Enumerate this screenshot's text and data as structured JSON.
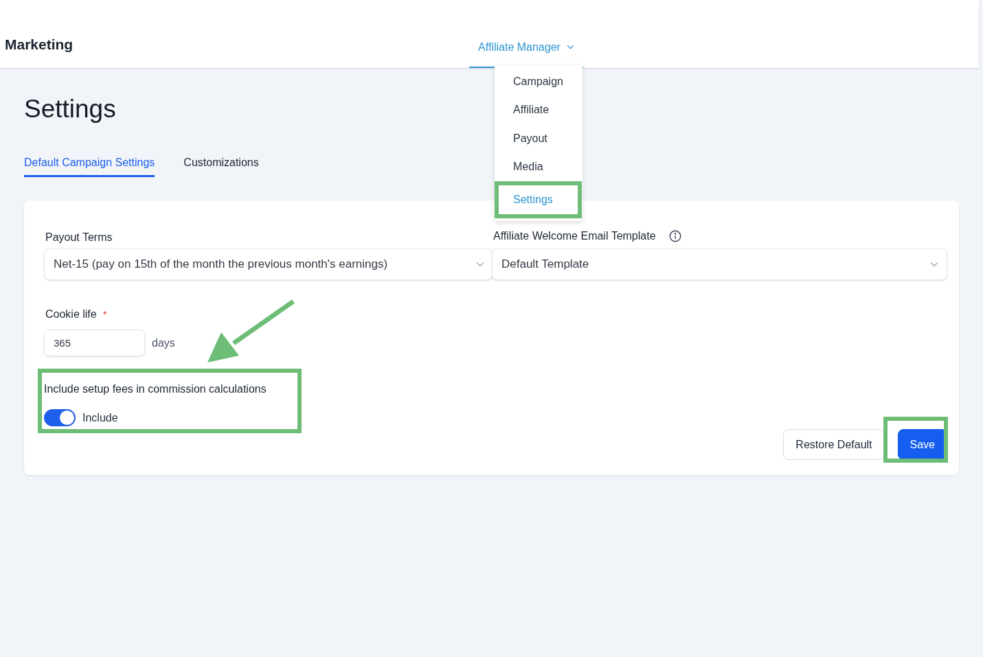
{
  "header": {
    "title": "Marketing",
    "nav_item": {
      "label": "Affiliate Manager",
      "expanded": true
    }
  },
  "nav_menu": [
    {
      "label": "Campaign",
      "selected": false
    },
    {
      "label": "Affiliate",
      "selected": false
    },
    {
      "label": "Payout",
      "selected": false
    },
    {
      "label": "Media",
      "selected": false
    },
    {
      "label": "Settings",
      "selected": true,
      "highlighted": true
    }
  ],
  "page_title": "Settings",
  "tabs": [
    {
      "label": "Default Campaign Settings",
      "selected": true
    },
    {
      "label": "Customizations",
      "selected": false
    }
  ],
  "payout_terms": {
    "label": "Payout Terms",
    "value": "Net-15 (pay on 15th of the month the previous month's earnings)"
  },
  "welcome_email": {
    "label": "Affiliate Welcome Email Template",
    "value": "Default Template"
  },
  "cookie_life": {
    "label": "Cookie life",
    "required_mark": "*",
    "value": "365",
    "unit": "days"
  },
  "setup_fees": {
    "label": "Include setup fees in commission calculations",
    "toggle_label": "Include",
    "on": true
  },
  "buttons": [
    {
      "label": "Restore Default",
      "kind": "secondary"
    },
    {
      "label": "Save",
      "kind": "primary"
    }
  ]
}
